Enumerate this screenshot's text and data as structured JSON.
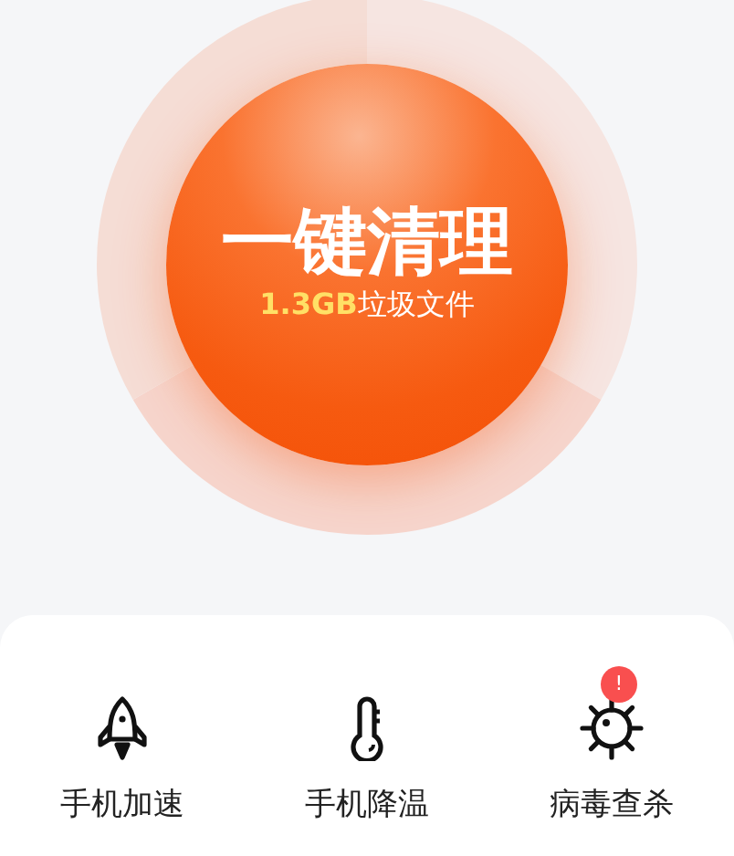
{
  "clean_button": {
    "title": "一键清理",
    "size": "1.3GB",
    "caption": "垃圾文件"
  },
  "tools": [
    {
      "label": "手机加速",
      "kind": "rocket"
    },
    {
      "label": "手机降温",
      "kind": "thermometer"
    },
    {
      "label": "病毒查杀",
      "kind": "virus",
      "badge": "!"
    }
  ]
}
